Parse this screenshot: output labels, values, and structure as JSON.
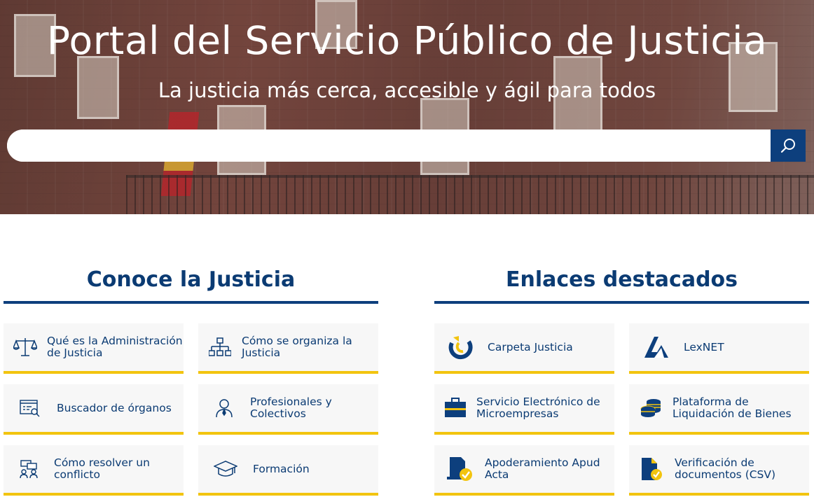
{
  "hero": {
    "title": "Portal del Servicio Público de Justicia",
    "subtitle": "La justicia más cerca, accesible y ágil para todos"
  },
  "search": {
    "value": "",
    "placeholder": "",
    "button_icon": "search-icon"
  },
  "conoce": {
    "title": "Conoce la Justicia",
    "items": [
      {
        "label": "Qué es la Administración de Justicia",
        "icon": "scales-icon"
      },
      {
        "label": "Cómo se organiza la Justicia",
        "icon": "org-chart-icon"
      },
      {
        "label": "Buscador de órganos",
        "icon": "directory-search-icon"
      },
      {
        "label": "Profesionales y Colectivos",
        "icon": "person-icon"
      },
      {
        "label": "Cómo resolver un conflicto",
        "icon": "mediation-icon"
      },
      {
        "label": "Formación",
        "icon": "graduation-cap-icon"
      }
    ]
  },
  "enlaces": {
    "title": "Enlaces destacados",
    "items": [
      {
        "label": "Carpeta Justicia",
        "icon": "carpeta-justicia-logo-icon"
      },
      {
        "label": "LexNET",
        "icon": "lexnet-logo-icon"
      },
      {
        "label": "Servicio Electrónico de Microempresas",
        "icon": "briefcase-icon"
      },
      {
        "label": "Plataforma de Liquidación de Bienes",
        "icon": "coins-icon"
      },
      {
        "label": "Apoderamiento Apud Acta",
        "icon": "document-check-icon"
      },
      {
        "label": "Verificación de documentos (CSV)",
        "icon": "file-check-icon"
      }
    ]
  },
  "colors": {
    "primary": "#0d3f7d",
    "accent": "#f2c40f",
    "card_bg": "#f7f7f7"
  }
}
